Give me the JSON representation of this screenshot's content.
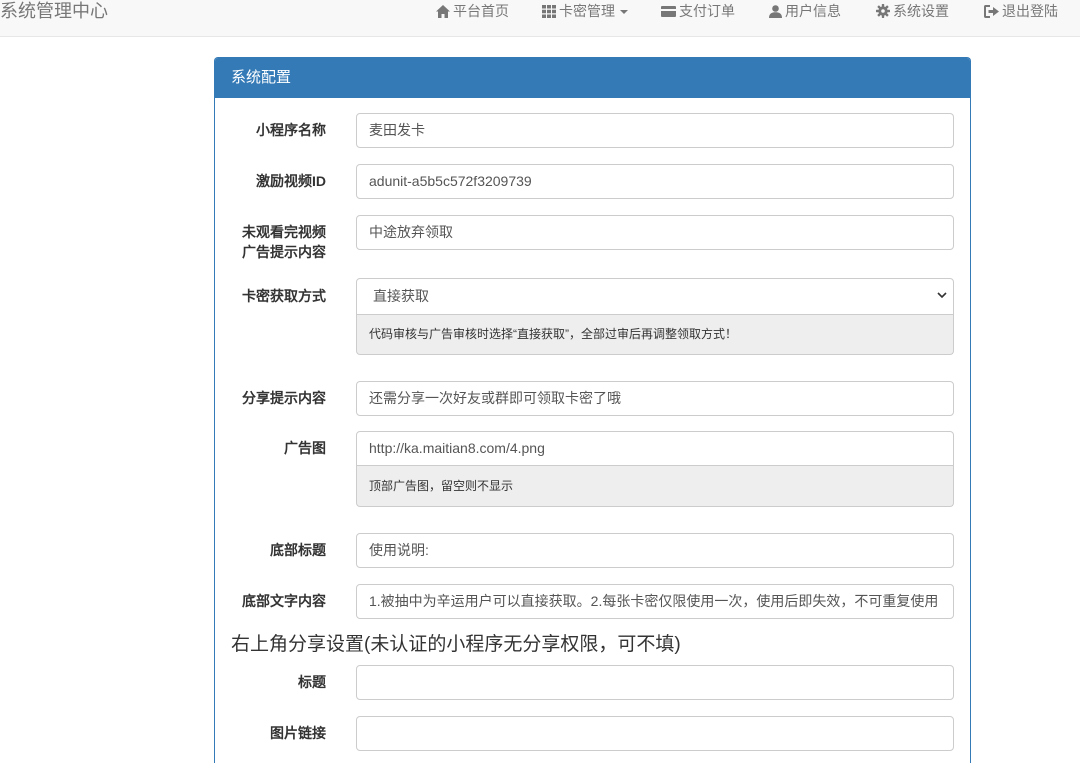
{
  "navbar": {
    "brand": "系统管理中心",
    "items": [
      {
        "label": "平台首页",
        "icon": "home-icon"
      },
      {
        "label": "卡密管理",
        "icon": "grid-icon"
      },
      {
        "label": "支付订单",
        "icon": "card-icon"
      },
      {
        "label": "用户信息",
        "icon": "user-icon"
      },
      {
        "label": "系统设置",
        "icon": "gear-icon"
      },
      {
        "label": "退出登陆",
        "icon": "logout-icon"
      }
    ]
  },
  "panel": {
    "title": "系统配置",
    "fields": {
      "app_name": {
        "label": "小程序名称",
        "value": "麦田发卡"
      },
      "video_id": {
        "label": "激励视频ID",
        "value": "adunit-a5b5c572f3209739"
      },
      "unwatched": {
        "label_line1": "未观看完视频",
        "label_line2": "广告提示内容",
        "value": "中途放弃领取"
      },
      "card_method": {
        "label": "卡密获取方式",
        "selected": "直接获取",
        "help": "代码审核与广告审核时选择“直接获取”，全部过审后再调整领取方式！"
      },
      "share_tip": {
        "label": "分享提示内容",
        "value": "还需分享一次好友或群即可领取卡密了哦"
      },
      "ad_image": {
        "label": "广告图",
        "value": "http://ka.maitian8.com/4.png",
        "help": "顶部广告图，留空则不显示"
      },
      "footer_title": {
        "label": "底部标题",
        "value": "使用说明:"
      },
      "footer_text": {
        "label": "底部文字内容",
        "value": "1.被抽中为辛运用户可以直接获取。2.每张卡密仅限使用一次，使用后即失效，不可重复使用"
      }
    },
    "share_section": {
      "title": "右上角分享设置(未认证的小程序无分享权限，可不填)",
      "share_title": {
        "label": "标题",
        "value": ""
      },
      "share_image": {
        "label": "图片链接",
        "value": ""
      }
    }
  }
}
